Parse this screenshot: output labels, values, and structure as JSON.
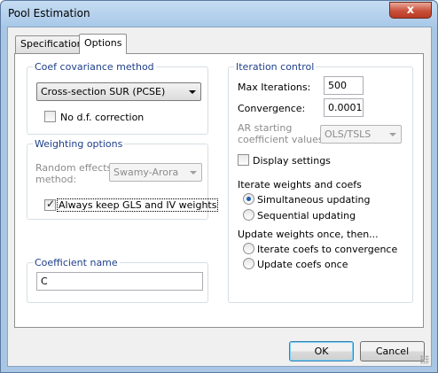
{
  "window": {
    "title": "Pool Estimation",
    "close_glyph": "x"
  },
  "tabs": [
    {
      "label": "Specification",
      "active": false
    },
    {
      "label": "Options",
      "active": true
    }
  ],
  "coef_covariance": {
    "legend": "Coef covariance method",
    "method_value": "Cross-section SUR (PCSE)",
    "no_df_correction_label": "No d.f. correction",
    "no_df_correction_checked": false
  },
  "weighting": {
    "legend": "Weighting options",
    "random_effects_label_line1": "Random effects",
    "random_effects_label_line2": "method:",
    "random_effects_value": "Swamy-Arora",
    "always_keep_label": "Always keep GLS and IV weights",
    "always_keep_checked": true
  },
  "coefficient_name": {
    "legend": "Coefficient name",
    "value": "C"
  },
  "iteration": {
    "legend": "Iteration control",
    "max_iterations_label": "Max Iterations:",
    "max_iterations_value": "500",
    "convergence_label": "Convergence:",
    "convergence_value": "0.0001",
    "ar_starting_line1": "AR starting",
    "ar_starting_line2": "coefficient values:",
    "ar_starting_value": "OLS/TSLS",
    "display_settings_label": "Display settings",
    "display_settings_checked": false,
    "iterate_heading": "Iterate weights and coefs",
    "simultaneous_label": "Simultaneous updating",
    "sequential_label": "Sequential updating",
    "iterate_selected": "simultaneous",
    "update_once_heading": "Update weights once, then...",
    "iterate_to_convergence_label": "Iterate coefs to convergence",
    "update_coefs_once_label": "Update coefs once",
    "update_once_selected": "none"
  },
  "buttons": {
    "ok": "OK",
    "cancel": "Cancel"
  },
  "colors": {
    "legend_text": "#1e3f8a",
    "radio_dot": "#1b5fb8",
    "title_bar": "#a8c8e8",
    "close_button": "#c9503a"
  }
}
